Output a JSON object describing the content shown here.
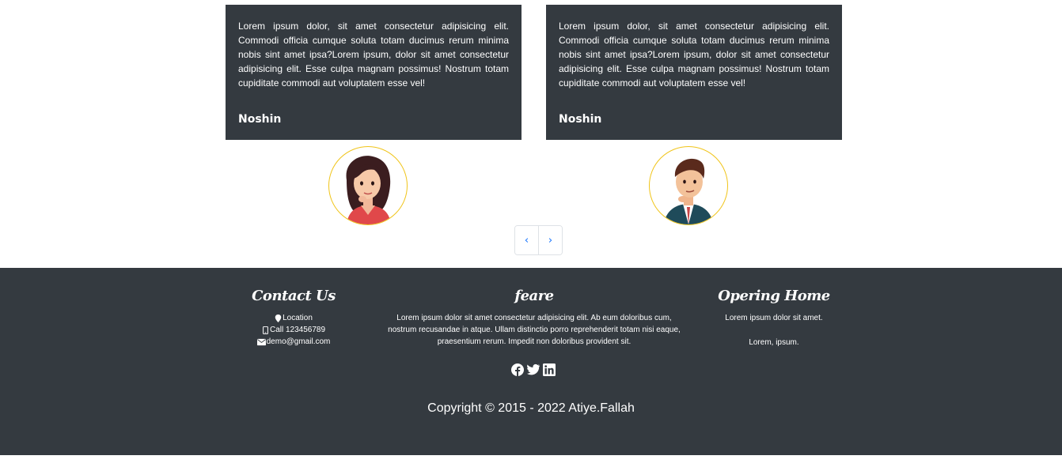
{
  "testimonials": [
    {
      "text": "Lorem ipsum dolor, sit amet consectetur adipisicing elit. Commodi officia cumque soluta totam ducimus rerum minima nobis sint amet ipsa?Lorem ipsum, dolor sit amet consectetur adipisicing elit. Esse culpa magnam possimus! Nostrum totam cupiditate commodi aut voluptatem esse vel!",
      "name": "Noshin",
      "avatar": "woman-avatar"
    },
    {
      "text": "Lorem ipsum dolor, sit amet consectetur adipisicing elit. Commodi officia cumque soluta totam ducimus rerum minima nobis sint amet ipsa?Lorem ipsum, dolor sit amet consectetur adipisicing elit. Esse culpa magnam possimus! Nostrum totam cupiditate commodi aut voluptatem esse vel!",
      "name": "Noshin",
      "avatar": "man-avatar"
    }
  ],
  "pager": {
    "prev_label": "‹",
    "next_label": "›"
  },
  "footer": {
    "contact": {
      "heading": "Contact Us",
      "location": "Location",
      "phone": "Call 123456789",
      "email": "demo@gmail.com"
    },
    "feare": {
      "heading": "feare",
      "text": "Lorem ipsum dolor sit amet consectetur adipisicing elit. Ab eum doloribus cum, nostrum recusandae in atque. Ullam distinctio porro reprehenderit totam nisi eaque, praesentium rerum. Impedit non doloribus provident sit."
    },
    "opening": {
      "heading": "Opering Home",
      "line1": "Lorem ipsum dolor sit amet.",
      "line2": "Lorem, ipsum."
    },
    "socials": [
      "facebook-icon",
      "twitter-icon",
      "linkedin-icon"
    ],
    "copyright": "Copyright © 2015 - 2022 Atiye.Fallah"
  },
  "colors": {
    "dark": "#343a40",
    "avatar_border": "#f0c419",
    "link": "#0d6efd"
  }
}
